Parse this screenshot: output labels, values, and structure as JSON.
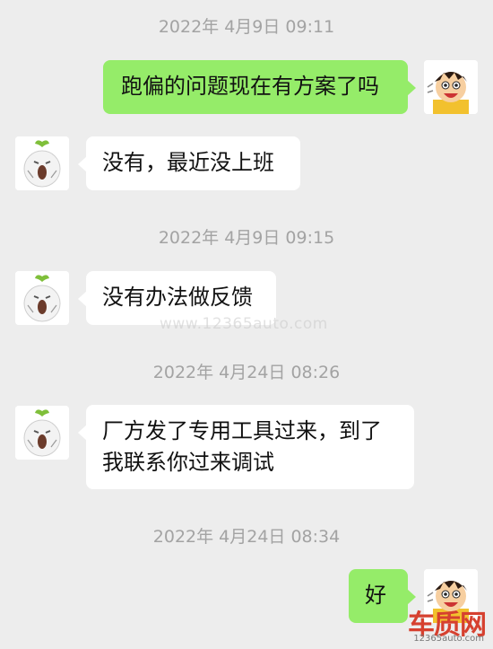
{
  "messages": [
    {
      "type": "time",
      "text": "2022年 4月9日 09:11"
    },
    {
      "type": "out",
      "text": "跑偏的问题现在有方案了吗"
    },
    {
      "type": "in",
      "text": "没有，最近没上班"
    },
    {
      "type": "time",
      "text": "2022年 4月9日 09:15"
    },
    {
      "type": "in",
      "text": "没有办法做反馈"
    },
    {
      "type": "time",
      "text": "2022年 4月24日 08:26"
    },
    {
      "type": "in",
      "lines": [
        "厂方发了专用工具过来，到了",
        "我联系你过来调试"
      ]
    },
    {
      "type": "time",
      "text": "2022年 4月24日 08:34"
    },
    {
      "type": "out",
      "text": "好"
    }
  ],
  "watermark": "www.12365auto.com",
  "logo": {
    "main": "车质网",
    "sub": "12365auto.com"
  },
  "avatars": {
    "self": "boy-avatar-icon",
    "other": "radish-avatar-icon"
  },
  "colors": {
    "background": "#ededed",
    "sent_bubble": "#95ec69",
    "received_bubble": "#ffffff",
    "timestamp": "#a3a3a3"
  }
}
